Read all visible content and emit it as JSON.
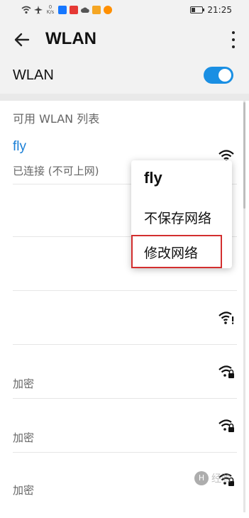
{
  "status_bar": {
    "speed_value": "0",
    "speed_unit": "K/s",
    "time": "21:25",
    "battery_level": 0.35,
    "app_icon_colors": [
      "#1677ff",
      "#e53935",
      "#f5a623",
      "#ff8f00"
    ]
  },
  "header": {
    "title": "WLAN",
    "back_icon": "arrow-left-icon",
    "more_icon": "more-vertical-icon"
  },
  "wlan_toggle": {
    "label": "WLAN",
    "enabled": true,
    "color": "#1a8fe3"
  },
  "available_list": {
    "title": "可用 WLAN 列表",
    "networks": [
      {
        "name": "fly",
        "status": "已连接 (不可上网)",
        "icon": "wifi-icon"
      },
      {
        "name": "",
        "status": "",
        "icon": ""
      },
      {
        "name": "",
        "status": "",
        "icon": ""
      },
      {
        "name": "",
        "status": "",
        "icon": "wifi-alert-icon"
      },
      {
        "name": "",
        "status": "加密",
        "icon": "wifi-lock-icon"
      },
      {
        "name": "",
        "status": "加密",
        "icon": "wifi-lock-icon"
      },
      {
        "name": "",
        "status": "加密",
        "icon": "wifi-lock-icon"
      }
    ]
  },
  "context_menu": {
    "title": "fly",
    "items": [
      "不保存网络",
      "修改网络"
    ],
    "highlight_color": "#d32f2f"
  },
  "watermark": {
    "logo_text": "H",
    "text": "经验"
  }
}
